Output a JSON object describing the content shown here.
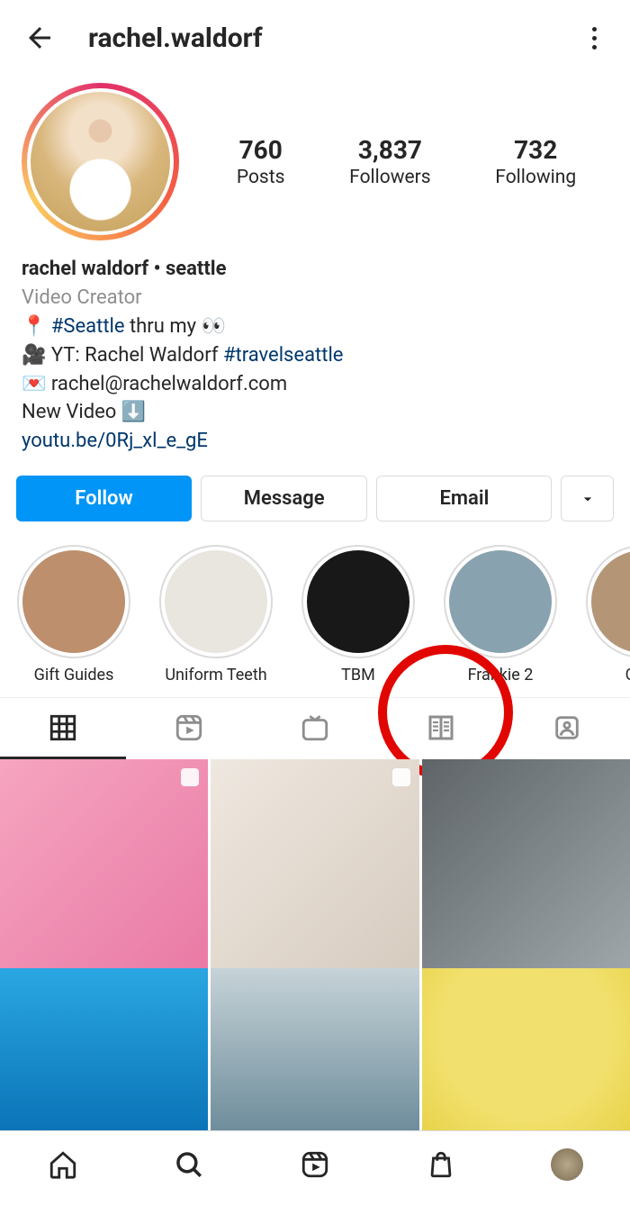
{
  "header": {
    "username": "rachel.waldorf"
  },
  "stats": {
    "posts": {
      "value": "760",
      "label": "Posts"
    },
    "followers": {
      "value": "3,837",
      "label": "Followers"
    },
    "following": {
      "value": "732",
      "label": "Following"
    }
  },
  "bio": {
    "display_name": "rachel waldorf • seattle",
    "category": "Video Creator",
    "line1_pin": "📍",
    "line1_hashtag": "#Seattle",
    "line1_rest": " thru my 👀",
    "line2_pre": "🎥 YT: Rachel Waldorf ",
    "line2_hashtag": "#travelseattle",
    "line3": "💌 rachel@rachelwaldorf.com",
    "line4": "New Video ⬇️",
    "link": "youtu.be/0Rj_xl_e_gE"
  },
  "actions": {
    "follow": "Follow",
    "message": "Message",
    "email": "Email"
  },
  "highlights": [
    {
      "label": "Gift Guides",
      "color": "#bd8f6c"
    },
    {
      "label": "Uniform Teeth",
      "color": "#e9e5df"
    },
    {
      "label": "TBM",
      "color": "#181818"
    },
    {
      "label": "Frankie 2",
      "color": "#89a2af"
    },
    {
      "label": "Ootd",
      "color": "#b49677"
    }
  ],
  "grid": {
    "row1": [
      {
        "bg": "linear-gradient(135deg,#f6a5c0,#e97aa5)",
        "carousel": true
      },
      {
        "bg": "linear-gradient(135deg,#efe8e0,#d6cbbf)",
        "carousel": true
      },
      {
        "bg": "linear-gradient(135deg,#5e6468,#9ea6aa)",
        "carousel": false
      }
    ],
    "row2": [
      {
        "bg": "linear-gradient(180deg,#2aa7e2 0%,#0b74b8 100%)"
      },
      {
        "bg": "linear-gradient(180deg,#c6d3d8 0%, #6e8d9b 100%)"
      },
      {
        "bg": "radial-gradient(circle at 50% 40%, #f1e06d 0 60%, #e8d34a 100%)"
      }
    ]
  }
}
